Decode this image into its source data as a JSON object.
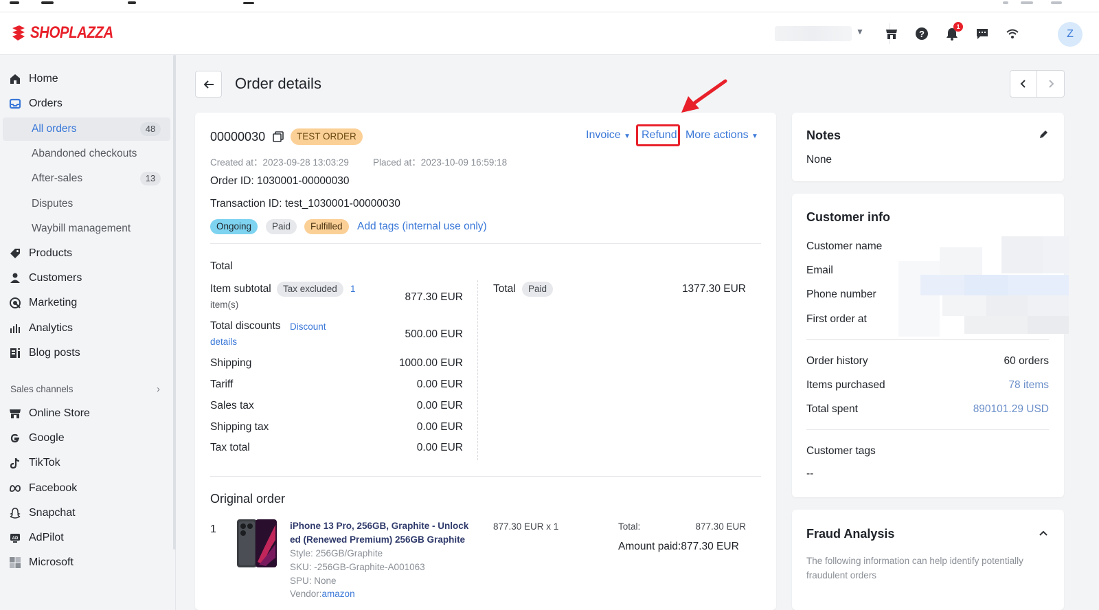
{
  "header": {
    "brand": "SHOPLAZZA",
    "notification_count": "1",
    "avatar_initial": "Z"
  },
  "sidebar": {
    "items": [
      {
        "label": "Home"
      },
      {
        "label": "Orders"
      },
      {
        "label": "Products"
      },
      {
        "label": "Customers"
      },
      {
        "label": "Marketing"
      },
      {
        "label": "Analytics"
      },
      {
        "label": "Blog posts"
      }
    ],
    "order_sub": [
      {
        "label": "All orders",
        "count": "48"
      },
      {
        "label": "Abandoned checkouts"
      },
      {
        "label": "After-sales",
        "count": "13"
      },
      {
        "label": "Disputes"
      },
      {
        "label": "Waybill management"
      }
    ],
    "sales_channels_title": "Sales channels",
    "channels": [
      {
        "label": "Online Store"
      },
      {
        "label": "Google"
      },
      {
        "label": "TikTok"
      },
      {
        "label": "Facebook"
      },
      {
        "label": "Snapchat"
      },
      {
        "label": "AdPilot"
      },
      {
        "label": "Microsoft"
      }
    ]
  },
  "page": {
    "title": "Order details"
  },
  "order": {
    "number": "00000030",
    "test_badge": "TEST ORDER",
    "actions": {
      "invoice": "Invoice",
      "refund": "Refund",
      "more": "More actions"
    },
    "created_label": "Created at：",
    "created_at": "2023-09-28 13:03:29",
    "placed_label": "Placed at：",
    "placed_at": "2023-10-09 16:59:18",
    "order_id": "Order ID: 1030001-00000030",
    "transaction_id": "Transaction ID: test_1030001-00000030",
    "status_tags": {
      "ongoing": "Ongoing",
      "paid": "Paid",
      "fulfilled": "Fulfilled"
    },
    "add_tags": "Add tags (internal use only)"
  },
  "totals": {
    "section_title": "Total",
    "item_subtotal_label": "Item subtotal",
    "tax_excluded": "Tax excluded",
    "items_count": "1",
    "items_word": "item(s)",
    "item_subtotal": "877.30 EUR",
    "discounts_label": "Total discounts",
    "discount_link_1": "Discount",
    "discount_link_2": "details",
    "discounts": "500.00 EUR",
    "shipping_label": "Shipping",
    "shipping": "1000.00 EUR",
    "tariff_label": "Tariff",
    "tariff": "0.00 EUR",
    "sales_tax_label": "Sales tax",
    "sales_tax": "0.00 EUR",
    "shipping_tax_label": "Shipping tax",
    "shipping_tax": "0.00 EUR",
    "tax_total_label": "Tax total",
    "tax_total": "0.00 EUR",
    "total_label": "Total",
    "total_status": "Paid",
    "total": "1377.30 EUR"
  },
  "original_order": {
    "title": "Original order",
    "index": "1",
    "product_name_1": "iPhone 13 Pro, 256GB, Graphite - Unlock",
    "product_name_2": "ed (Renewed Premium) 256GB Graphite",
    "style": "Style: 256GB/Graphite",
    "sku": "SKU: -256GB-Graphite-A001063",
    "spu": "SPU: None",
    "vendor_label": "Vendor:",
    "vendor": "amazon",
    "unit_price": "877.30 EUR x 1",
    "total_label": "Total:",
    "total": "877.30 EUR",
    "amount_paid": "Amount paid:877.30 EUR"
  },
  "notes": {
    "title": "Notes",
    "value": "None"
  },
  "customer_info": {
    "title": "Customer info",
    "name_label": "Customer name",
    "email_label": "Email",
    "phone_label": "Phone number",
    "first_order_label": "First order at",
    "order_history_label": "Order history",
    "order_history": "60 orders",
    "items_purchased_label": "Items purchased",
    "items_purchased": "78 items",
    "total_spent_label": "Total spent",
    "total_spent": "890101.29 USD",
    "tags_label": "Customer tags",
    "tags_value": "--"
  },
  "fraud": {
    "title": "Fraud Analysis",
    "desc_1": "The following information can help identify potentially",
    "desc_2": "fraudulent orders"
  },
  "colors": {
    "brand": "#e8202a",
    "link": "#3a78d8",
    "ongoing": "#7dd3f0",
    "fulfilled": "#fbd097",
    "test_order": "#fbd097"
  }
}
